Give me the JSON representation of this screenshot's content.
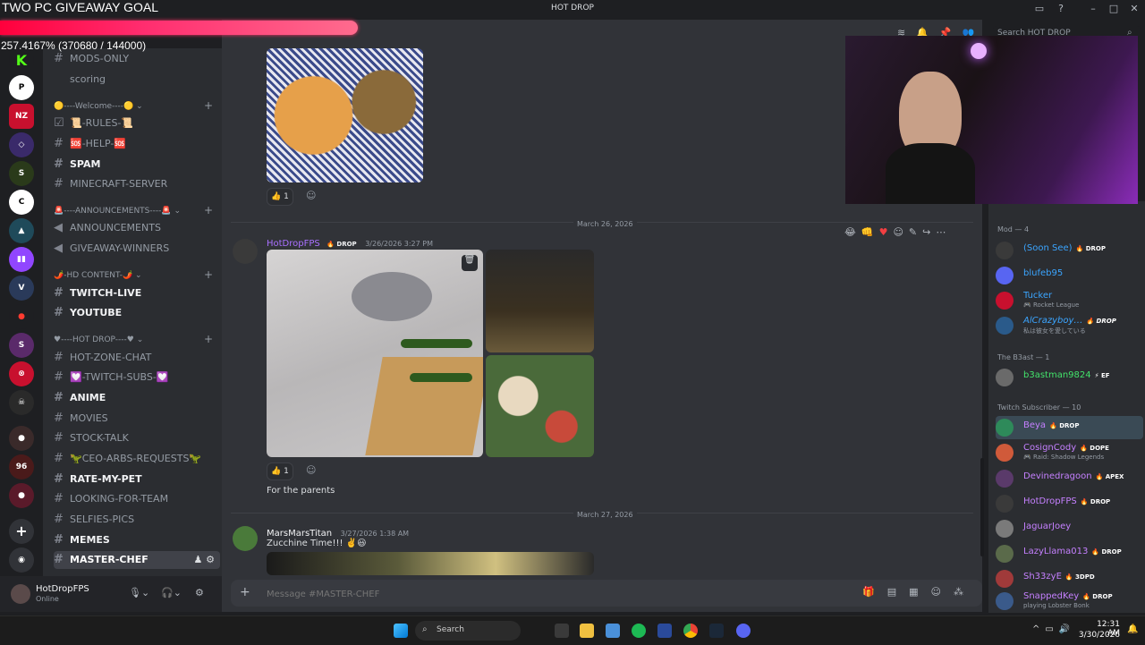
{
  "overlay": {
    "goal_title": "TWO PC GIVEAWAY GOAL",
    "goal_progress": "257.4167% (370680 / 144000)",
    "goal_fraction": 2.574
  },
  "window": {
    "title": "HOT DROP",
    "search_placeholder": "Search HOT DROP"
  },
  "sidebar": {
    "channels_top": [
      {
        "label": "MODS-ONLY",
        "bold": false
      },
      {
        "label": "scoring",
        "bold": false
      }
    ],
    "cat_welcome": "🟡----Welcome----🟡",
    "welcome_channels": [
      {
        "label": "📜-RULES-📜"
      },
      {
        "label": "🆘-HELP-🆘"
      },
      {
        "label": "SPAM"
      },
      {
        "label": "MINECRAFT-SERVER"
      }
    ],
    "cat_announce": "🚨----ANNOUNCEMENTS----🚨",
    "announce_channels": [
      {
        "label": "ANNOUNCEMENTS"
      },
      {
        "label": "GIVEAWAY-WINNERS"
      }
    ],
    "cat_content": "🌶️-HD CONTENT-🌶️",
    "content_channels": [
      {
        "label": "TWITCH-LIVE"
      },
      {
        "label": "YOUTUBE"
      }
    ],
    "cat_hotdrop": "♥----HOT DROP----♥",
    "hotdrop_channels": [
      {
        "label": "HOT-ZONE-CHAT"
      },
      {
        "label": "💟-TWITCH-SUBS-💟"
      },
      {
        "label": "ANIME"
      },
      {
        "label": "MOVIES"
      },
      {
        "label": "STOCK-TALK"
      },
      {
        "label": "🦖CEO-ARBS-REQUESTS🦖"
      },
      {
        "label": "RATE-MY-PET"
      },
      {
        "label": "LOOKING-FOR-TEAM"
      },
      {
        "label": "SELFIES-PICS"
      },
      {
        "label": "MEMES"
      },
      {
        "label": "MASTER-CHEF"
      }
    ]
  },
  "user": {
    "name": "HotDropFPS",
    "status": "Online"
  },
  "messages": {
    "reaction_1": "👍 1",
    "date_1": "March 26, 2026",
    "msg_author": "HotDropFPS",
    "msg_badge": "🔥 DROP",
    "msg_time": "3/26/2026 3:27 PM",
    "reaction_2": "👍 1",
    "msg_text": "For the parents",
    "date_2": "March 27, 2026",
    "msg2_author": "MarsMarsTitan",
    "msg2_time": "3/27/2026 1:38 AM",
    "msg2_text": "Zucchine Time!!! ✌️😃"
  },
  "composer": {
    "placeholder": "Message #MASTER-CHEF"
  },
  "members": {
    "group_mod": "Mod — 4",
    "mods": [
      {
        "name": "(Soon See)",
        "badge": "🔥 DROP",
        "color": "#3ba5ff",
        "status": ""
      },
      {
        "name": "blufeb95",
        "badge": "",
        "color": "#3ba5ff",
        "status": ""
      },
      {
        "name": "Tucker",
        "badge": "",
        "color": "#3ba5ff",
        "status": "🎮 Rocket League"
      },
      {
        "name": "AlCrazyboy…",
        "badge": "🔥 DROP",
        "color": "#3ba5ff",
        "status": "私は彼女を愛している"
      }
    ],
    "group_b3": "The B3ast — 1",
    "b3": [
      {
        "name": "b3astman9824",
        "badge": "⚡ EF",
        "color": "#43e36b",
        "status": ""
      }
    ],
    "group_sub": "Twitch Subscriber — 10",
    "subs": [
      {
        "name": "Beya",
        "badge": "🔥 DROP",
        "color": "#c580ff",
        "status": ""
      },
      {
        "name": "CosignCody",
        "badge": "🔥 DOPE",
        "color": "#c580ff",
        "status": "🎮 Raid: Shadow Legends"
      },
      {
        "name": "Devinedragoon",
        "badge": "🔥 APEX",
        "color": "#c580ff",
        "status": ""
      },
      {
        "name": "HotDropFPS",
        "badge": "🔥 DROP",
        "color": "#c580ff",
        "status": ""
      },
      {
        "name": "JaguarJoey",
        "badge": "",
        "color": "#c580ff",
        "status": ""
      },
      {
        "name": "LazyLlama013",
        "badge": "🔥 DROP",
        "color": "#c580ff",
        "status": ""
      },
      {
        "name": "Sh33zyE",
        "badge": "🔥 3DPD",
        "color": "#c580ff",
        "status": ""
      },
      {
        "name": "SnappedKey",
        "badge": "🔥 DROP",
        "color": "#c580ff",
        "status": "playing Lobster Bonk"
      }
    ]
  },
  "taskbar": {
    "search": "Search",
    "time": "12:31 AM",
    "date": "3/30/2026"
  },
  "colors": {
    "accent": "#5865f2",
    "brand_red": "#ff2d55",
    "purple_name": "#a970ff"
  }
}
